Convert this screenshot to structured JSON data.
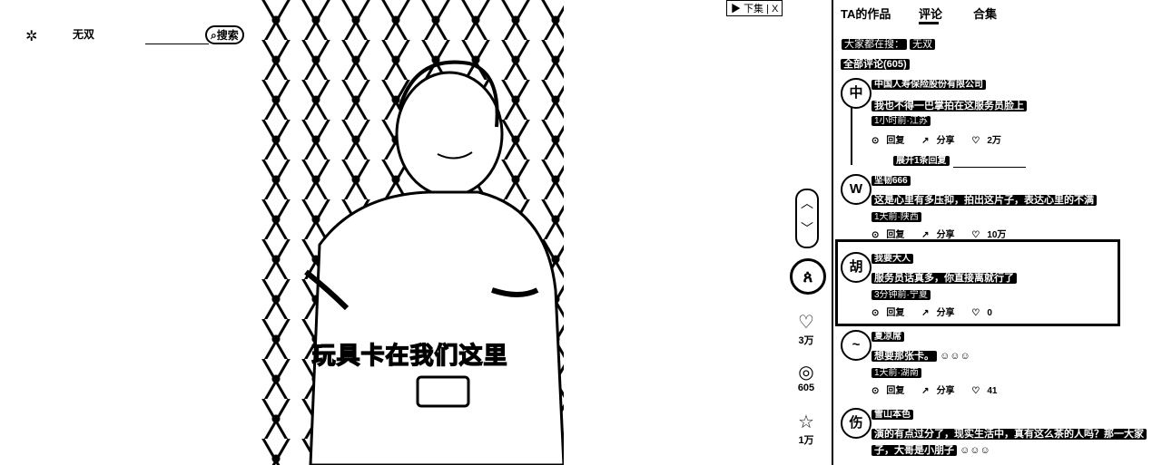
{
  "search": {
    "value": "无双",
    "button_label": "搜索"
  },
  "video": {
    "subtitle": "玩具卡在我们这里"
  },
  "actions": {
    "likes": "3万",
    "comments": "605",
    "favorites": "1万"
  },
  "header": {
    "next_label": "▶ 下集 | X"
  },
  "tabs": [
    {
      "label": "TA的作品"
    },
    {
      "label": "评论"
    },
    {
      "label": "合集"
    }
  ],
  "related": {
    "prefix": "大家都在搜：",
    "term": "无双"
  },
  "comments_header": "全部评论(605)",
  "comments": [
    {
      "avatar": "中",
      "user": "中国人寿保险股份有限公司",
      "text": "我也不得一巴掌拍在这服务员脸上",
      "meta": "1小时前·江苏",
      "reply": "回复",
      "share": "分享",
      "likes": "2万"
    },
    {
      "avatar": "W",
      "user": "坚韧666",
      "text": "这是心里有多压抑，拍出这片子，表达心里的不满",
      "meta": "1天前·陕西",
      "reply": "回复",
      "share": "分享",
      "likes": "10万"
    },
    {
      "avatar": "胡",
      "user": "我要大人",
      "text": "服务员话真多，你直接离就行了",
      "meta": "3分钟前·宁夏",
      "reply": "回复",
      "share": "分享",
      "likes": "0"
    },
    {
      "avatar": "~",
      "user": "夏凉席",
      "text": "想要那张卡。",
      "meta": "1天前·湖南",
      "reply": "回复",
      "share": "分享",
      "likes": "41"
    },
    {
      "avatar": "伤",
      "user": "雪山本色",
      "text": "演的有点过分了，现实生活中，真有这么茶的人吗？那一大家",
      "text2": "子，大哥是小朋子",
      "meta": "",
      "reply": "",
      "share": "",
      "likes": ""
    }
  ],
  "expand_replies": "展开1条回复"
}
